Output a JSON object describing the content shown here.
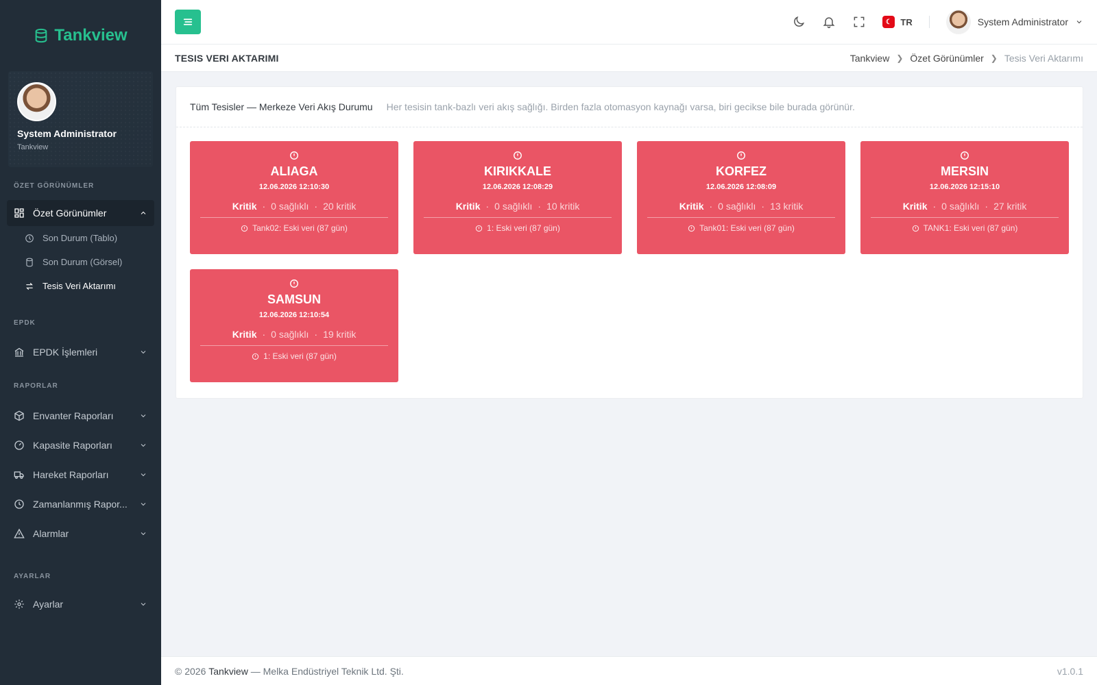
{
  "brand": {
    "name": "Tankview"
  },
  "profile": {
    "name": "System Administrator",
    "org": "Tankview"
  },
  "sidebar": {
    "sections": {
      "overview": "ÖZET GÖRÜNÜMLER",
      "epdk": "EPDK",
      "reports": "RAPORLAR",
      "settings": "AYARLAR"
    },
    "overview_item": "Özet Görünümler",
    "overview_sub": [
      "Son Durum (Tablo)",
      "Son Durum (Görsel)",
      "Tesis Veri Aktarımı"
    ],
    "epdk_item": "EPDK İşlemleri",
    "report_items": [
      "Envanter Raporları",
      "Kapasite Raporları",
      "Hareket Raporları",
      "Zamanlanmış Rapor...",
      "Alarmlar"
    ],
    "settings_item": "Ayarlar"
  },
  "topbar": {
    "lang": "TR",
    "flag": "☾",
    "user": "System Administrator"
  },
  "page": {
    "title": "TESIS VERI AKTARIMI",
    "breadcrumb": [
      "Tankview",
      "Özet Görünümler",
      "Tesis Veri Aktarımı"
    ]
  },
  "card": {
    "title": "Tüm Tesisler — Merkeze Veri Akış Durumu",
    "desc": "Her tesisin tank-bazlı veri akış sağlığı. Birden fazla otomasyon kaynağı varsa, biri gecikse bile burada görünür."
  },
  "facilities": [
    {
      "name": "ALIAGA",
      "time": "12.06.2026 12:10:30",
      "status": "Kritik",
      "healthy": "0 sağlıklı",
      "critical": "20 kritik",
      "note": "Tank02: Eski veri (87 gün)"
    },
    {
      "name": "KIRIKKALE",
      "time": "12.06.2026 12:08:29",
      "status": "Kritik",
      "healthy": "0 sağlıklı",
      "critical": "10 kritik",
      "note": "1: Eski veri (87 gün)"
    },
    {
      "name": "KORFEZ",
      "time": "12.06.2026 12:08:09",
      "status": "Kritik",
      "healthy": "0 sağlıklı",
      "critical": "13 kritik",
      "note": "Tank01: Eski veri (87 gün)"
    },
    {
      "name": "MERSIN",
      "time": "12.06.2026 12:15:10",
      "status": "Kritik",
      "healthy": "0 sağlıklı",
      "critical": "27 kritik",
      "note": "TANK1: Eski veri (87 gün)"
    },
    {
      "name": "SAMSUN",
      "time": "12.06.2026 12:10:54",
      "status": "Kritik",
      "healthy": "0 sağlıklı",
      "critical": "19 kritik",
      "note": "1: Eski veri (87 gün)"
    }
  ],
  "footer": {
    "prefix": "© 2026",
    "brand": "Tankview",
    "suffix": "— Melka Endüstriyel Teknik Ltd. Şti.",
    "version": "v1.0.1"
  },
  "colors": {
    "accent": "#27c08f",
    "critical": "#ea5565",
    "sidebar": "#222d38"
  }
}
